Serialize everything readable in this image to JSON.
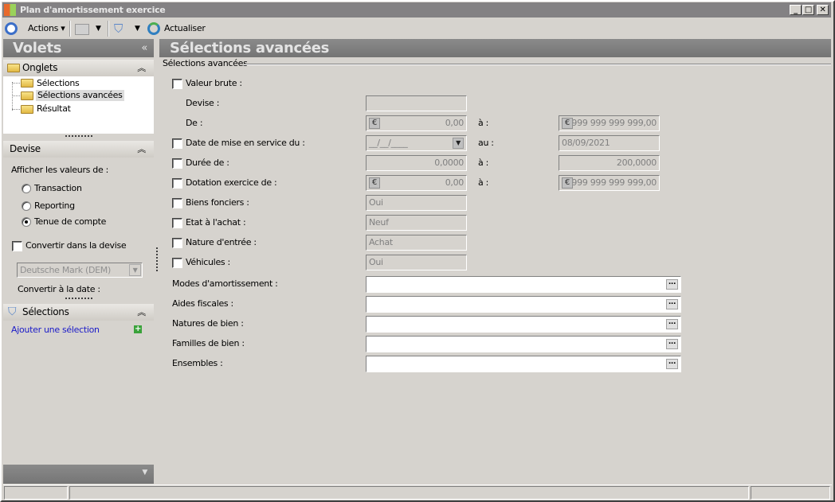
{
  "window": {
    "title": "Plan d'amortissement exercice",
    "minimize": "_",
    "maximize": "□",
    "close": "✕"
  },
  "toolbar": {
    "actions": "Actions",
    "refresh": "Actualiser"
  },
  "left": {
    "title": "Volets",
    "collapse": "«",
    "onglets": {
      "title": "Onglets",
      "items": [
        "Sélections",
        "Sélections avancées",
        "Résultat"
      ]
    },
    "devise": {
      "title": "Devise",
      "show_label": "Afficher les valeurs de :",
      "options": [
        "Transaction",
        "Reporting",
        "Tenue de compte"
      ],
      "selected": 2,
      "convert_label": "Convertir dans la devise",
      "currency": "Deutsche Mark (DEM)",
      "date_label": "Convertir à la date :"
    },
    "selections": {
      "title": "Sélections",
      "add": "Ajouter une sélection"
    }
  },
  "main": {
    "title": "Sélections avancées",
    "group": "Sélections avancées",
    "valeur_brute": "Valeur brute :",
    "devise": "Devise :",
    "de": "De :",
    "de_from": "0,00",
    "a": "à :",
    "de_to": "999 999 999 999,00",
    "date": "Date de mise en service du :",
    "date_from": "__/__/____",
    "au": "au :",
    "date_to": "08/09/2021",
    "duree": "Durée de :",
    "duree_from": "0,0000",
    "duree_to": "200,0000",
    "dotation": "Dotation exercice de :",
    "dot_from": "0,00",
    "dot_to": "999 999 999 999,00",
    "biens": "Biens fonciers :",
    "biens_val": "Oui",
    "etat": "Etat à l'achat :",
    "etat_val": "Neuf",
    "nature": "Nature d'entrée :",
    "nature_val": "Achat",
    "vehicules": "Véhicules :",
    "vehicules_val": "Oui",
    "lookups": [
      "Modes d'amortissement :",
      "Aides fiscales :",
      "Natures de bien :",
      "Familles de bien :",
      "Ensembles :"
    ],
    "dots": "..."
  }
}
